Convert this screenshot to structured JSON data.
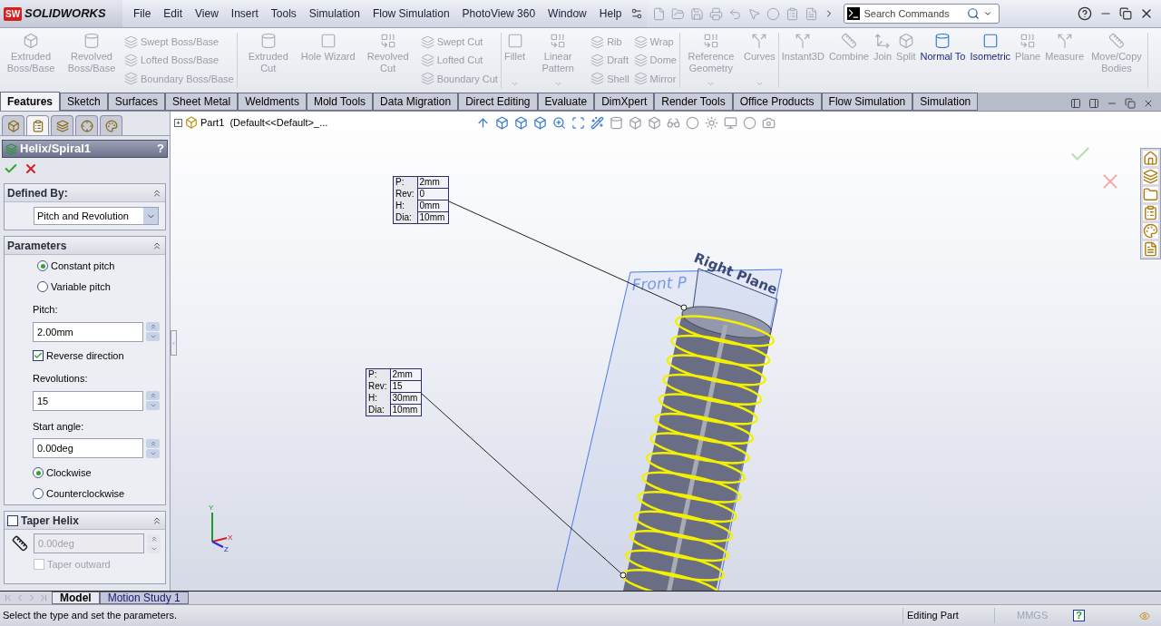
{
  "title_bar": {
    "logo_badge": "SW",
    "logo": "SOLIDWORKS",
    "menu": [
      "File",
      "Edit",
      "View",
      "Insert",
      "Tools",
      "Simulation",
      "Flow Simulation",
      "PhotoView 360",
      "Window",
      "Help"
    ],
    "search": {
      "placeholder": "Search Commands"
    }
  },
  "ribbon": [
    {
      "columns": [
        {
          "kind": "large",
          "label": "Extruded Boss/Base",
          "disabled": true,
          "dropdown": false
        },
        {
          "kind": "large",
          "label": "Revolved Boss/Base",
          "disabled": true,
          "dropdown": false
        },
        {
          "kind": "stack",
          "items": [
            {
              "label": "Swept Boss/Base",
              "disabled": true
            },
            {
              "label": "Lofted Boss/Base",
              "disabled": true
            },
            {
              "label": "Boundary Boss/Base",
              "disabled": true
            }
          ]
        }
      ]
    },
    {
      "columns": [
        {
          "kind": "large",
          "label": "Extruded Cut",
          "disabled": true,
          "dropdown": false
        },
        {
          "kind": "large",
          "label": "Hole Wizard",
          "disabled": true,
          "dropdown": false
        },
        {
          "kind": "large",
          "label": "Revolved Cut",
          "disabled": true,
          "dropdown": false
        },
        {
          "kind": "stack",
          "items": [
            {
              "label": "Swept Cut",
              "disabled": true
            },
            {
              "label": "Lofted Cut",
              "disabled": true
            },
            {
              "label": "Boundary Cut",
              "disabled": true
            }
          ]
        }
      ]
    },
    {
      "columns": [
        {
          "kind": "large",
          "label": "Fillet",
          "disabled": true,
          "dropdown": true
        },
        {
          "kind": "large",
          "label": "Linear Pattern",
          "disabled": true,
          "dropdown": true
        },
        {
          "kind": "stack",
          "items": [
            {
              "label": "Rib",
              "disabled": true
            },
            {
              "label": "Draft",
              "disabled": true
            },
            {
              "label": "Shell",
              "disabled": true
            }
          ]
        },
        {
          "kind": "stack",
          "items": [
            {
              "label": "Wrap",
              "disabled": true
            },
            {
              "label": "Dome",
              "disabled": true
            },
            {
              "label": "Mirror",
              "disabled": true
            }
          ]
        }
      ]
    },
    {
      "columns": [
        {
          "kind": "large",
          "label": "Reference Geometry",
          "disabled": true,
          "dropdown": true
        },
        {
          "kind": "large",
          "label": "Curves",
          "disabled": true,
          "dropdown": true
        }
      ]
    },
    {
      "columns": [
        {
          "kind": "large",
          "label": "Instant3D",
          "disabled": true,
          "dropdown": false
        },
        {
          "kind": "large",
          "label": "Combine",
          "disabled": true,
          "dropdown": false
        },
        {
          "kind": "large",
          "label": "Join",
          "disabled": true,
          "dropdown": false
        },
        {
          "kind": "large",
          "label": "Split",
          "disabled": true,
          "dropdown": false
        },
        {
          "kind": "large",
          "label": "Normal To",
          "disabled": false,
          "dropdown": false
        },
        {
          "kind": "large",
          "label": "Isometric",
          "disabled": false,
          "dropdown": false
        },
        {
          "kind": "large",
          "label": "Plane",
          "disabled": true,
          "dropdown": false
        },
        {
          "kind": "large",
          "label": "Measure",
          "disabled": true,
          "dropdown": false
        },
        {
          "kind": "large",
          "label": "Move/Copy Bodies",
          "disabled": true,
          "dropdown": false
        }
      ]
    }
  ],
  "tabs": [
    {
      "label": "Features",
      "selected": true
    },
    {
      "label": "Sketch",
      "selected": false
    },
    {
      "label": "Surfaces",
      "selected": false
    },
    {
      "label": "Sheet Metal",
      "selected": false
    },
    {
      "label": "Weldments",
      "selected": false
    },
    {
      "label": "Mold Tools",
      "selected": false
    },
    {
      "label": "Data Migration",
      "selected": false
    },
    {
      "label": "Direct Editing",
      "selected": false
    },
    {
      "label": "Evaluate",
      "selected": false
    },
    {
      "label": "DimXpert",
      "selected": false
    },
    {
      "label": "Render Tools",
      "selected": false
    },
    {
      "label": "Office Products",
      "selected": false
    },
    {
      "label": "Flow Simulation",
      "selected": false
    },
    {
      "label": "Simulation",
      "selected": false
    }
  ],
  "property_manager": {
    "panel_tabs": [
      {
        "selected": false
      },
      {
        "selected": true
      },
      {
        "selected": false
      },
      {
        "selected": false
      },
      {
        "selected": false
      }
    ],
    "title": "Helix/Spiral1",
    "help": "?",
    "defined_by": {
      "title": "Defined By:",
      "value": "Pitch and Revolution"
    },
    "parameters": {
      "title": "Parameters",
      "pitch_type": [
        {
          "label": "Constant pitch",
          "selected": true
        },
        {
          "label": "Variable pitch",
          "selected": false
        }
      ],
      "pitch": {
        "label": "Pitch:",
        "value": "2.00mm"
      },
      "reverse": {
        "label": "Reverse direction",
        "checked": true
      },
      "revolutions": {
        "label": "Revolutions:",
        "value": "15"
      },
      "start_angle": {
        "label": "Start angle:",
        "value": "0.00deg"
      },
      "direction": [
        {
          "label": "Clockwise",
          "selected": true
        },
        {
          "label": "Counterclockwise",
          "selected": false
        }
      ]
    },
    "taper": {
      "title": "Taper Helix",
      "checked": false,
      "angle": {
        "value": "0.00deg",
        "disabled": true
      },
      "outward": {
        "label": "Taper outward",
        "checked": false,
        "disabled": true
      }
    }
  },
  "viewport": {
    "tree_expand": "+",
    "tree": "Part1  (Default<<Default>_...",
    "callouts": [
      {
        "rows": [
          {
            "label": "P:",
            "value": "2mm"
          },
          {
            "label": "Rev:",
            "value": "0"
          },
          {
            "label": "H:",
            "value": "0mm"
          },
          {
            "label": "Dia:",
            "value": "10mm"
          }
        ]
      },
      {
        "rows": [
          {
            "label": "P:",
            "value": "2mm"
          },
          {
            "label": "Rev:",
            "value": "15"
          },
          {
            "label": "H:",
            "value": "30mm"
          },
          {
            "label": "Dia:",
            "value": "10mm"
          }
        ]
      }
    ],
    "planes": [
      "Front P",
      "Right Plane"
    ],
    "triad": [
      "Y",
      "X",
      "Z"
    ]
  },
  "bottom_tabs": [
    {
      "label": "Model",
      "selected": true
    },
    {
      "label": "Motion Study 1",
      "selected": false
    }
  ],
  "status_bar": {
    "message": "Select the type and set the parameters.",
    "mode": "Editing Part",
    "units": "MMGS",
    "help": "?"
  }
}
